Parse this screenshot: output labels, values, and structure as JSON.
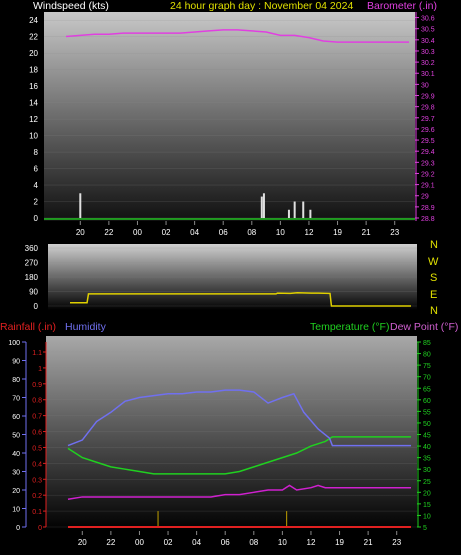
{
  "header": {
    "left": "Windspeed (kts)",
    "center": "24 hour graph day : November 04 2024",
    "right": "Barometer (.in)"
  },
  "panel3_labels": {
    "rainfall": "Rainfall (.in)",
    "humidity": "Humidity",
    "temperature": "Temperature (°F)",
    "dewpoint": "Dew Point (°F)"
  },
  "compass": [
    "N",
    "W",
    "S",
    "E",
    "N"
  ],
  "colors": {
    "windspeed": "#e0e0e0",
    "barometer": "#e040e0",
    "direction": "#e0d000",
    "humidity": "#7070f0",
    "temperature": "#20d020",
    "dewpoint": "#d020d0",
    "rainfall": "#e02020",
    "title": "#e0e000",
    "header_left": "#ffffff",
    "temp_axis": "#20d020",
    "rain_axis": "#e02020",
    "humidity_axis": "#7070f0"
  },
  "chart_data": [
    {
      "type": "bar+line",
      "name": "wind-baro",
      "x_ticks": [
        "20",
        "22",
        "00",
        "02",
        "04",
        "06",
        "08",
        "10",
        "12",
        "19",
        "21",
        "23"
      ],
      "y_left": {
        "label": "Windspeed (kts)",
        "ticks": [
          "0",
          "2",
          "4",
          "6",
          "8",
          "10",
          "12",
          "14",
          "16",
          "18",
          "20",
          "22",
          "24"
        ],
        "lim": [
          0,
          25
        ]
      },
      "y_right": {
        "label": "Barometer (.in)",
        "ticks": [
          "28.8",
          "28.9",
          "29",
          "29.1",
          "29.2",
          "29.3",
          "29.4",
          "29.5",
          "29.6",
          "29.7",
          "29.8",
          "29.9",
          "30",
          "30.1",
          "30.2",
          "30.3",
          "30.4",
          "30.5",
          "30.6"
        ],
        "lim": [
          28.8,
          30.65
        ]
      },
      "wind_bars": [
        {
          "x": 1.0,
          "v": 3.0
        },
        {
          "x": 13.7,
          "v": 2.6
        },
        {
          "x": 13.85,
          "v": 3.0
        },
        {
          "x": 15.6,
          "v": 1.0
        },
        {
          "x": 16.0,
          "v": 2.0
        },
        {
          "x": 16.6,
          "v": 2.0
        },
        {
          "x": 17.1,
          "v": 1.0
        }
      ],
      "barometer": [
        [
          0,
          30.43
        ],
        [
          1,
          30.44
        ],
        [
          2,
          30.45
        ],
        [
          3,
          30.45
        ],
        [
          4,
          30.46
        ],
        [
          5,
          30.46
        ],
        [
          6,
          30.46
        ],
        [
          7,
          30.46
        ],
        [
          8,
          30.46
        ],
        [
          9,
          30.47
        ],
        [
          10,
          30.48
        ],
        [
          11,
          30.49
        ],
        [
          12,
          30.49
        ],
        [
          13,
          30.48
        ],
        [
          14,
          30.47
        ],
        [
          15,
          30.44
        ],
        [
          16,
          30.44
        ],
        [
          17,
          30.42
        ],
        [
          18,
          30.39
        ],
        [
          19,
          30.38
        ],
        [
          20,
          30.38
        ],
        [
          21,
          30.38
        ],
        [
          22,
          30.38
        ],
        [
          23,
          30.38
        ],
        [
          24,
          30.38
        ]
      ]
    },
    {
      "type": "line",
      "name": "wind-direction",
      "y_ticks": [
        "0",
        "90",
        "180",
        "270",
        "360"
      ],
      "lim": [
        0,
        360
      ],
      "direction": [
        [
          0,
          20
        ],
        [
          1.2,
          20
        ],
        [
          1.3,
          75
        ],
        [
          5,
          75
        ],
        [
          10,
          75
        ],
        [
          14.5,
          75
        ],
        [
          14.6,
          80
        ],
        [
          15.5,
          78
        ],
        [
          16,
          82
        ],
        [
          17,
          80
        ],
        [
          17.5,
          80
        ],
        [
          18.3,
          78
        ],
        [
          18.4,
          0
        ],
        [
          24,
          0
        ]
      ]
    },
    {
      "type": "line",
      "name": "humidity-temp",
      "rain_ticks": [
        "0",
        "0.1",
        "0.2",
        "0.3",
        "0.4",
        "0.5",
        "0.6",
        "0.7",
        "0.8",
        "0.9",
        "1",
        "1.1"
      ],
      "humidity_ticks": [
        "0",
        "10",
        "20",
        "30",
        "40",
        "50",
        "60",
        "70",
        "80",
        "90",
        "100"
      ],
      "temp_ticks": [
        "5",
        "10",
        "15",
        "20",
        "25",
        "30",
        "35",
        "40",
        "45",
        "50",
        "55",
        "60",
        "65",
        "70",
        "75",
        "80",
        "85"
      ],
      "humidity": [
        [
          0,
          44
        ],
        [
          1,
          47
        ],
        [
          2,
          57
        ],
        [
          3,
          62
        ],
        [
          4,
          68
        ],
        [
          5,
          70
        ],
        [
          6,
          71
        ],
        [
          7,
          72
        ],
        [
          8,
          72
        ],
        [
          9,
          73
        ],
        [
          10,
          73
        ],
        [
          11,
          74
        ],
        [
          12,
          74
        ],
        [
          13,
          73
        ],
        [
          14,
          67
        ],
        [
          15,
          70
        ],
        [
          15.8,
          72
        ],
        [
          16.5,
          62
        ],
        [
          17.5,
          53
        ],
        [
          18.3,
          48
        ],
        [
          18.5,
          44
        ],
        [
          19,
          44
        ],
        [
          20,
          44
        ],
        [
          21,
          44
        ],
        [
          22,
          44
        ],
        [
          23,
          44
        ],
        [
          24,
          44
        ]
      ],
      "temperature": [
        [
          0,
          39
        ],
        [
          1,
          35
        ],
        [
          2,
          33
        ],
        [
          3,
          31
        ],
        [
          4,
          30
        ],
        [
          5,
          29
        ],
        [
          6,
          28
        ],
        [
          7,
          28
        ],
        [
          8,
          28
        ],
        [
          9,
          28
        ],
        [
          10,
          28
        ],
        [
          11,
          28
        ],
        [
          12,
          29
        ],
        [
          13,
          31
        ],
        [
          14,
          33
        ],
        [
          15,
          35
        ],
        [
          16,
          37
        ],
        [
          17,
          40
        ],
        [
          18,
          42
        ],
        [
          18.5,
          44
        ],
        [
          19,
          44
        ],
        [
          20,
          44
        ],
        [
          21,
          44
        ],
        [
          22,
          44
        ],
        [
          23,
          44
        ],
        [
          24,
          44
        ]
      ],
      "dewpoint": [
        [
          0,
          17
        ],
        [
          1,
          18
        ],
        [
          2,
          18
        ],
        [
          3,
          18
        ],
        [
          4,
          18
        ],
        [
          5,
          18
        ],
        [
          6,
          18
        ],
        [
          7,
          18
        ],
        [
          8,
          18
        ],
        [
          9,
          18
        ],
        [
          10,
          18
        ],
        [
          11,
          19
        ],
        [
          12,
          19
        ],
        [
          13,
          20
        ],
        [
          14,
          21
        ],
        [
          15,
          21
        ],
        [
          15.5,
          23
        ],
        [
          16,
          21
        ],
        [
          17,
          22
        ],
        [
          17.5,
          23
        ],
        [
          18,
          22
        ],
        [
          18.5,
          22
        ],
        [
          19,
          22
        ],
        [
          20,
          22
        ],
        [
          21,
          22
        ],
        [
          22,
          22
        ],
        [
          23,
          22
        ],
        [
          24,
          22
        ]
      ],
      "rainfall": [
        [
          0,
          0
        ],
        [
          24,
          0
        ]
      ],
      "rain_spikes": [
        {
          "x": 6.3,
          "v": 0.1
        },
        {
          "x": 15.3,
          "v": 0.1
        }
      ]
    }
  ]
}
